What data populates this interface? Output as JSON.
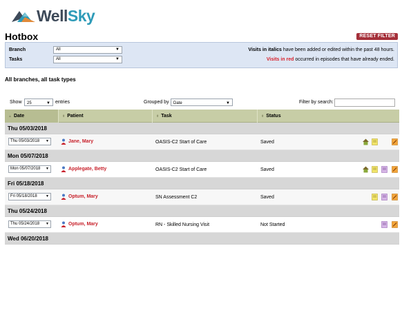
{
  "brand": {
    "name_part1": "Well",
    "name_part2": "Sky"
  },
  "page": {
    "title": "Hotbox",
    "reset_button": "RESET FILTER",
    "subheading": "All branches, all task types"
  },
  "filters": {
    "branch": {
      "label": "Branch",
      "value": "All"
    },
    "tasks": {
      "label": "Tasks",
      "value": "All"
    },
    "legend_italics_strong": "Visits in italics",
    "legend_italics_rest": "have been added or edited within the past 48 hours.",
    "legend_red_strong": "Visits in red",
    "legend_red_rest": "occurred in episodes that have already ended."
  },
  "table_controls": {
    "show_label": "Show",
    "show_value": "25",
    "entries_label": "entries",
    "grouped_label": "Grouped by",
    "grouped_value": "Date",
    "search_label": "Filter by search:",
    "search_value": ""
  },
  "columns": {
    "date": "Date",
    "patient": "Patient",
    "task": "Task",
    "status": "Status"
  },
  "groups": [
    {
      "label": "Thu 05/03/2018",
      "row": {
        "date": "Thu 05/03/2018",
        "patient": "Jane, Mary",
        "task": "OASIS-C2 Start of Care",
        "status": "Saved"
      }
    },
    {
      "label": "Mon 05/07/2018",
      "row": {
        "date": "Mon 05/07/2018",
        "patient": "Applegate, Betty",
        "task": "OASIS-C2 Start of Care",
        "status": "Saved"
      }
    },
    {
      "label": "Fri 05/18/2018",
      "row": {
        "date": "Fri 05/18/2018",
        "patient": "Optum, Mary",
        "task": "SN Assessment C2",
        "status": "Saved"
      }
    },
    {
      "label": "Thu 05/24/2018",
      "row": {
        "date": "Thu 05/24/2018",
        "patient": "Optum, Mary",
        "task": "RN - Skilled Nursing Visit",
        "status": "Not Started"
      }
    },
    {
      "label": "Wed 06/20/2018"
    }
  ],
  "colors": {
    "accent_red": "#c8202a",
    "reset_bg": "#a5303a",
    "header_bg": "#c7cda6",
    "filter_bg": "#dde6f4"
  },
  "icons": [
    "house-icon",
    "note-icon",
    "document-icon",
    "edit-icon",
    "patient-icon"
  ]
}
